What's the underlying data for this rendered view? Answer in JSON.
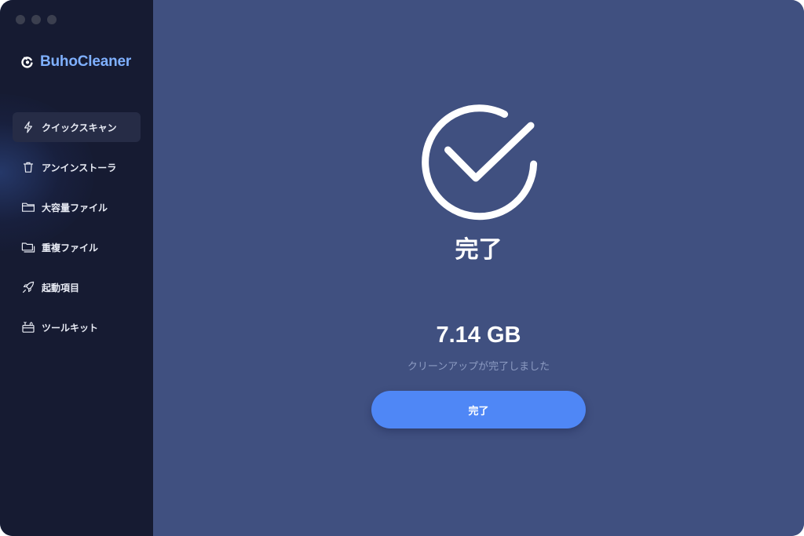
{
  "app": {
    "name": "BuhoCleaner",
    "brand_color": "#7fb0ff"
  },
  "window": {
    "traffic_lights": [
      "close",
      "minimize",
      "zoom"
    ]
  },
  "sidebar": {
    "items": [
      {
        "label": "クイックスキャン",
        "icon": "lightning-bolt-icon",
        "active": true
      },
      {
        "label": "アンインストーラ",
        "icon": "trash-icon",
        "active": false
      },
      {
        "label": "大容量ファイル",
        "icon": "folder-icon",
        "active": false
      },
      {
        "label": "重複ファイル",
        "icon": "duplicate-folder-icon",
        "active": false
      },
      {
        "label": "起動項目",
        "icon": "rocket-icon",
        "active": false
      },
      {
        "label": "ツールキット",
        "icon": "toolbox-icon",
        "active": false
      }
    ]
  },
  "main": {
    "status_icon": "checkmark-circle-icon",
    "status_title": "完了",
    "cleaned_size": "7.14 GB",
    "caption": "クリーンアップが完了しました",
    "done_button_label": "完了",
    "accent_color": "#4f87f6",
    "background_color": "#405080"
  }
}
